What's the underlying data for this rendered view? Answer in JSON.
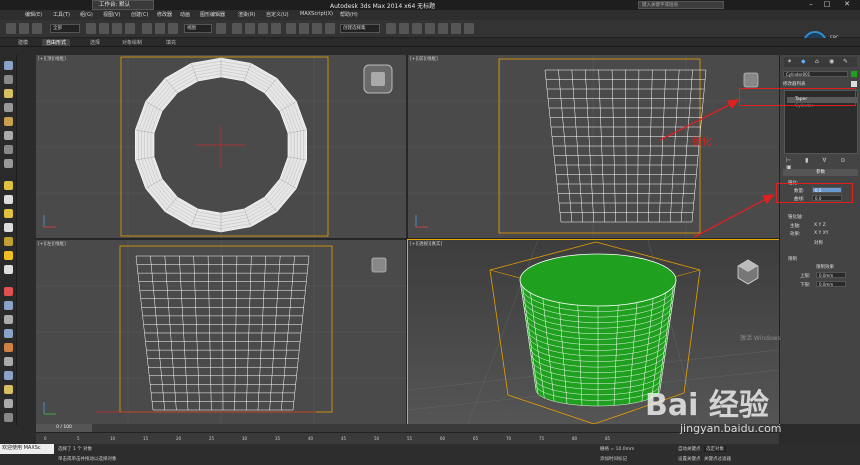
{
  "window": {
    "title": "Autodesk 3ds Max  2014 x64     无标题",
    "file_tab": "工作台: 默认",
    "help_search_placeholder": "键入关键字或短语"
  },
  "menu": [
    "编辑(E)",
    "工具(T)",
    "组(G)",
    "视图(V)",
    "创建(C)",
    "修改器",
    "动画",
    "图形编辑器",
    "渲染(R)",
    "自定义(U)",
    "MAXScript(X)",
    "帮助(H)"
  ],
  "toolbar": {
    "select_filter": "全部",
    "view_dropdown": "视图",
    "selection_set": "创建选择集"
  },
  "ribbon_tabs": [
    "建模",
    "自由形式",
    "选择",
    "对象绘制",
    "填充"
  ],
  "ribbon_active": 1,
  "viewports": [
    {
      "label": "[+][顶][线框]"
    },
    {
      "label": "[+][前][线框]"
    },
    {
      "label": "[+][左][线框]"
    },
    {
      "label": "[+][透视][真实]"
    }
  ],
  "cpu": {
    "percent": "52%",
    "unit": "EPC",
    "label": "CPU 利用率"
  },
  "command_panel": {
    "object_name": "Cylinder001",
    "modifier_list": "修改器列表",
    "stack": [
      {
        "name": "Taper",
        "selected": true
      },
      {
        "name": "Cylinder",
        "selected": false
      }
    ],
    "rollout_title": "参数",
    "taper_group": "锥化:",
    "amount_label": "数量:",
    "amount_value": "0.5",
    "curve_label": "曲线:",
    "curve_value": "0.0",
    "taper_axis_label": "锥化轴:",
    "primary_label": "主轴:",
    "primary_axes": "X  Y  Z",
    "effect_label": "效果:",
    "effect_axes": "X  Y  XY",
    "symmetry_label": "对称",
    "limits_label": "限制",
    "limit_effect_label": "限制效果",
    "upper_label": "上限:",
    "upper_value": "0.0mm",
    "lower_label": "下限:",
    "lower_value": "0.0mm"
  },
  "annotation": {
    "text": "锥化",
    "color": "#e02020"
  },
  "timeline": {
    "frame_readout": "0 / 100",
    "ticks": [
      "0",
      "5",
      "10",
      "15",
      "20",
      "25",
      "30",
      "35",
      "40",
      "45",
      "50",
      "55",
      "60",
      "65",
      "70",
      "75",
      "80",
      "85"
    ]
  },
  "status": {
    "welcome": "欢迎使用 MAXSc",
    "selection": "选择了 1 个 对象",
    "prompt": "单击或单击并拖动以选择对象",
    "grid": "栅格 = 10.0mm",
    "auto_key": "自动关键点",
    "set_key": "设置关键点",
    "selected_obj": "选定对象",
    "key_filter": "关键点过滤器",
    "add_time_tag": "添加时间标记"
  },
  "watermark": {
    "brand": "Bai 经验",
    "url": "jingyan.baidu.com",
    "activate": "激活 Windows"
  },
  "colors": {
    "cylinder_fill": "#1fa01f",
    "wire_white": "#ffffff",
    "bbox_orange": "#e8a000",
    "annot_red": "#e02020"
  }
}
